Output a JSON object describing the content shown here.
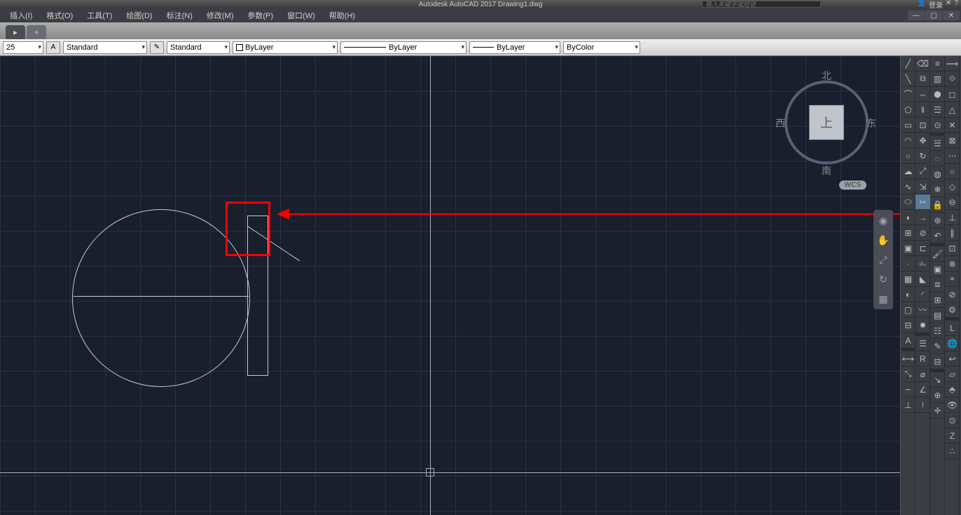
{
  "title": "Autodesk AutoCAD 2017   Drawing1.dwg",
  "search_placeholder": "输入关键字或短语",
  "login": "登录",
  "menu": [
    "插入(I)",
    "格式(O)",
    "工具(T)",
    "绘图(D)",
    "标注(N)",
    "修改(M)",
    "参数(P)",
    "窗口(W)",
    "帮助(H)"
  ],
  "propbar": {
    "dim_scale": "25",
    "text_style": "Standard",
    "dim_style": "Standard",
    "color": "ByLayer",
    "linetype": "ByLayer",
    "lineweight": "ByLayer",
    "plot_style": "ByColor"
  },
  "viewcube": {
    "top": "上",
    "north": "北",
    "south": "南",
    "east": "东",
    "west": "西",
    "wcs": "WCS"
  }
}
